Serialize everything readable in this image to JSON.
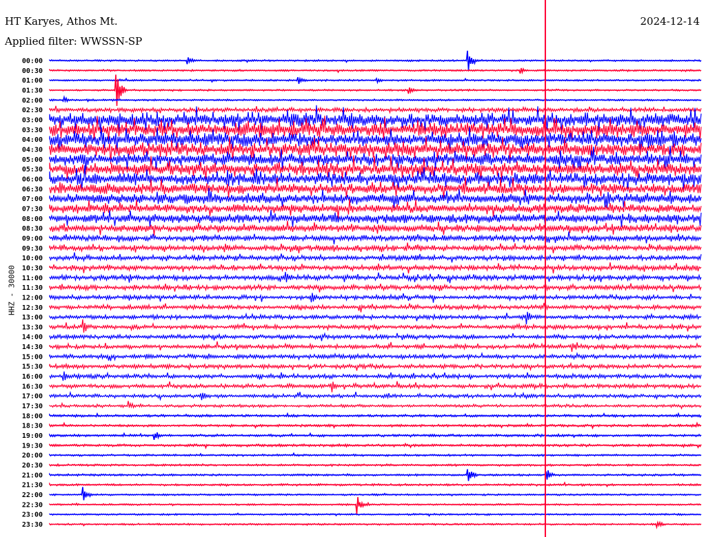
{
  "header": {
    "station": "HT Karyes, Athos Mt.",
    "filter": "Applied filter: WWSSN-SP",
    "date": "2024-12-14"
  },
  "chart_data": {
    "type": "line",
    "title": "HT Karyes, Athos Mt.",
    "subtitle": "Applied filter: WWSSN-SP",
    "date": "2024-12-14",
    "ylabel": "HHZ - 30000",
    "xrange_minutes": [
      0,
      30
    ],
    "colors": {
      "even": "#0000ff",
      "odd": "#ff0033"
    },
    "rows": [
      "00:00",
      "00:30",
      "01:00",
      "01:30",
      "02:00",
      "02:30",
      "03:00",
      "03:30",
      "04:00",
      "04:30",
      "05:00",
      "05:30",
      "06:00",
      "06:30",
      "07:00",
      "07:30",
      "08:00",
      "08:30",
      "09:00",
      "09:30",
      "10:00",
      "10:30",
      "11:00",
      "11:30",
      "12:00",
      "12:30",
      "13:00",
      "13:30",
      "14:00",
      "14:30",
      "15:00",
      "15:30",
      "16:00",
      "16:30",
      "17:00",
      "17:30",
      "18:00",
      "18:30",
      "19:00",
      "19:30",
      "20:00",
      "20:30",
      "21:00",
      "21:30",
      "22:00",
      "22:30",
      "23:00",
      "23:30"
    ],
    "noise_level": [
      1,
      1,
      1,
      1,
      1,
      3,
      9,
      9,
      9,
      9,
      8,
      8,
      8,
      7,
      7,
      6,
      6,
      5,
      4,
      4,
      3.5,
      3.5,
      3.5,
      3.5,
      3,
      3,
      3,
      3,
      3,
      3,
      3,
      3,
      3,
      3,
      2.5,
      2,
      1.5,
      1.5,
      1.5,
      1.5,
      1.2,
      1.2,
      1.2,
      1.2,
      1,
      1,
      1,
      1
    ],
    "events": [
      [
        0,
        0.21,
        8
      ],
      [
        0,
        0.64,
        22
      ],
      [
        1,
        0.72,
        6
      ],
      [
        2,
        0.38,
        10
      ],
      [
        2,
        0.5,
        6
      ],
      [
        3,
        0.55,
        8
      ],
      [
        4,
        0.02,
        6
      ],
      [
        3,
        0.1,
        40
      ],
      [
        18,
        0.37,
        10
      ],
      [
        20,
        0.56,
        12
      ],
      [
        22,
        0.36,
        14
      ],
      [
        24,
        0.4,
        12
      ],
      [
        26,
        0.73,
        14
      ],
      [
        27,
        0.05,
        14
      ],
      [
        29,
        0.8,
        12
      ],
      [
        32,
        0.02,
        12
      ],
      [
        33,
        0.43,
        14
      ],
      [
        34,
        0.23,
        14
      ],
      [
        35,
        0.12,
        10
      ],
      [
        38,
        0.16,
        10
      ],
      [
        42,
        0.64,
        16
      ],
      [
        42,
        0.76,
        14
      ],
      [
        44,
        0.05,
        14
      ],
      [
        45,
        0.47,
        16
      ],
      [
        47,
        0.93,
        8
      ]
    ],
    "major_event_minute": 22.8
  }
}
